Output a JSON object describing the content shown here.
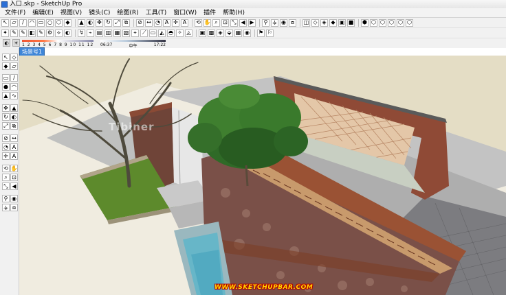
{
  "window": {
    "title": "入口.skp - SketchUp Pro"
  },
  "menu": [
    "文件(F)",
    "编辑(E)",
    "视图(V)",
    "镜头(C)",
    "绘图(R)",
    "工具(T)",
    "窗口(W)",
    "插件",
    "帮助(H)"
  ],
  "shadow_settings": {
    "scale_label": "1 2 3 4 5 6 7 8 9 10 11 12",
    "time_start": "06:37",
    "time_mid": "中午",
    "time_end": "17:22"
  },
  "scenes": {
    "active_tab": "场景号1"
  },
  "viewport": {
    "watermark": "Tibiner",
    "footer_url": "WWW.SKETCHUPBAR.COM"
  },
  "toolbar_icons_row1": [
    "select-icon",
    "eraser-icon",
    "pencil-icon",
    "arc-icon",
    "rectangle-icon",
    "circle-icon",
    "polygon-icon",
    "pushpull-icon",
    "move-icon",
    "rotate-icon",
    "scale-icon",
    "offset-icon",
    "tape-icon",
    "text-icon",
    "orbit-icon",
    "pan-icon",
    "zoom-icon",
    "zoom-extents-icon"
  ],
  "colors": {
    "viewport_bg": "#e4ddc5",
    "scene_tab": "#3f86d8"
  }
}
